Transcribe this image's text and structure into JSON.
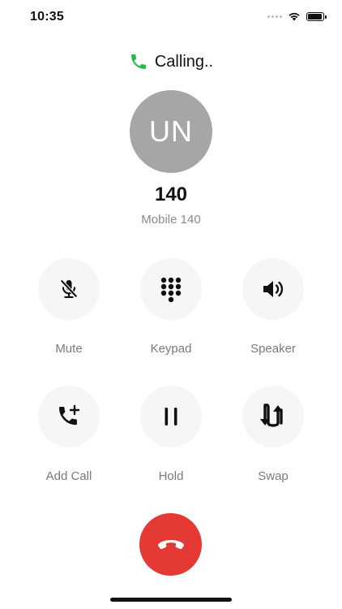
{
  "status_bar": {
    "time": "10:35"
  },
  "call": {
    "status_text": "Calling..",
    "status_icon": "phone-icon",
    "status_color": "#2bb84a"
  },
  "contact": {
    "initials": "UN",
    "name": "140",
    "subtitle": "Mobile 140",
    "avatar_color": "#a6a6a6"
  },
  "controls": {
    "mute": {
      "label": "Mute",
      "icon": "microphone-off-icon"
    },
    "keypad": {
      "label": "Keypad",
      "icon": "keypad-icon"
    },
    "speaker": {
      "label": "Speaker",
      "icon": "speaker-icon"
    },
    "add_call": {
      "label": "Add Call",
      "icon": "add-call-icon"
    },
    "hold": {
      "label": "Hold",
      "icon": "pause-icon"
    },
    "swap": {
      "label": "Swap",
      "icon": "swap-icon"
    }
  },
  "end_call": {
    "icon": "hang-up-icon",
    "color": "#e53935"
  }
}
